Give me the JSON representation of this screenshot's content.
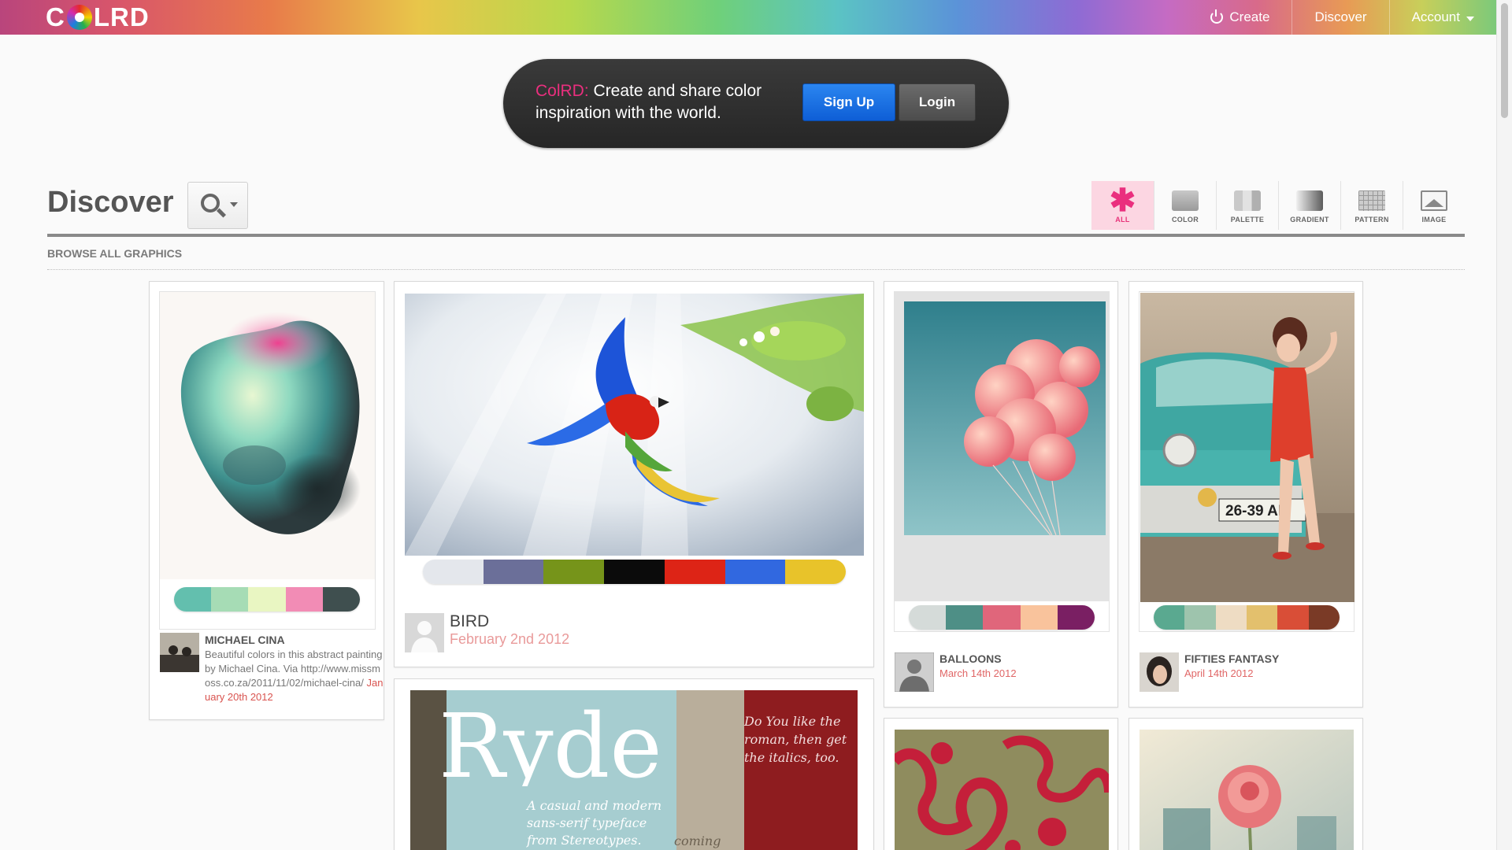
{
  "header": {
    "logo": "C  LRD",
    "nav": {
      "create": "Create",
      "discover": "Discover",
      "account": "Account"
    }
  },
  "promo": {
    "brand": "ColRD:",
    "text": " Create and share color inspiration with the world.",
    "signup": "Sign Up",
    "login": "Login"
  },
  "discover": {
    "title": "Discover",
    "browse_label": "BROWSE ALL GRAPHICS",
    "filters": [
      "ALL",
      "COLOR",
      "PALETTE",
      "GRADIENT",
      "PATTERN",
      "IMAGE"
    ],
    "active_filter": "ALL"
  },
  "cards": [
    {
      "title": "MICHAEL CINA",
      "description": "Beautiful colors in this abstract painting by Michael Cina. Via http://www.missmoss.co.za/2011/11/02/michael-cina/",
      "date": "January 20th 2012",
      "palette": [
        "#63bfae",
        "#a6dcb5",
        "#e9f6c2",
        "#f28cb5",
        "#3f4f4f"
      ]
    },
    {
      "title": "BIRD",
      "date": "February 2nd 2012",
      "palette": [
        "#e4e7ec",
        "#6b6f99",
        "#76941a",
        "#0b0b0b",
        "#dd2416",
        "#3168e0",
        "#e8c32a"
      ]
    },
    {
      "title": "BALLOONS",
      "date": "March 14th 2012",
      "palette": [
        "#d5dbd9",
        "#4e8f86",
        "#e0667b",
        "#f9c39c",
        "#7a1f63"
      ]
    },
    {
      "title": "FIFTIES FANTASY",
      "date": "April 14th 2012",
      "palette": [
        "#5aa990",
        "#9ec4ad",
        "#eedcc3",
        "#e3c06d",
        "#d94e37",
        "#7a3a26"
      ]
    }
  ],
  "ryde_poster": {
    "word": "Ryde",
    "tagline": "A casual and modern sans-serif typeface from Stereotypes.",
    "side": "Do You like the roman, then get the italics, too.",
    "coming": "coming"
  },
  "colors": {
    "accent": "#ea2f7e",
    "date": "#e06666",
    "signup": "#1a6fe6"
  }
}
